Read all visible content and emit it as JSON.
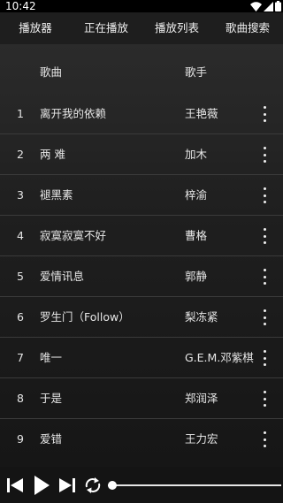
{
  "status": {
    "time": "10:42"
  },
  "tabs": [
    "播放器",
    "正在播放",
    "播放列表",
    "歌曲搜索"
  ],
  "list_header": {
    "song": "歌曲",
    "artist": "歌手"
  },
  "songs": [
    {
      "index": "1",
      "title": "离开我的依赖",
      "artist": "王艳薇"
    },
    {
      "index": "2",
      "title": "两 难",
      "artist": "加木"
    },
    {
      "index": "3",
      "title": "褪黑素",
      "artist": "梓渝"
    },
    {
      "index": "4",
      "title": "寂寞寂寞不好",
      "artist": "曹格"
    },
    {
      "index": "5",
      "title": "爱情讯息",
      "artist": "郭静"
    },
    {
      "index": "6",
      "title": "罗生门（Follow）",
      "artist": "梨冻紧"
    },
    {
      "index": "7",
      "title": "唯一",
      "artist": "G.E.M.邓紫棋"
    },
    {
      "index": "8",
      "title": "于是",
      "artist": "郑润泽"
    },
    {
      "index": "9",
      "title": "爱错",
      "artist": "王力宏"
    }
  ],
  "player": {
    "progress": 0.0
  },
  "icons": {
    "previous": "skip-previous-icon",
    "play": "play-icon",
    "next": "skip-next-icon",
    "repeat": "repeat-icon",
    "more": "more-vert-icon",
    "wifi": "wifi-icon",
    "signal": "signal-icon",
    "battery": "battery-icon"
  },
  "colors": {
    "background": "#000000",
    "tab_bar": "#1e1e1e",
    "text": "#e6e6e6",
    "divider": "#3a3a3a"
  }
}
